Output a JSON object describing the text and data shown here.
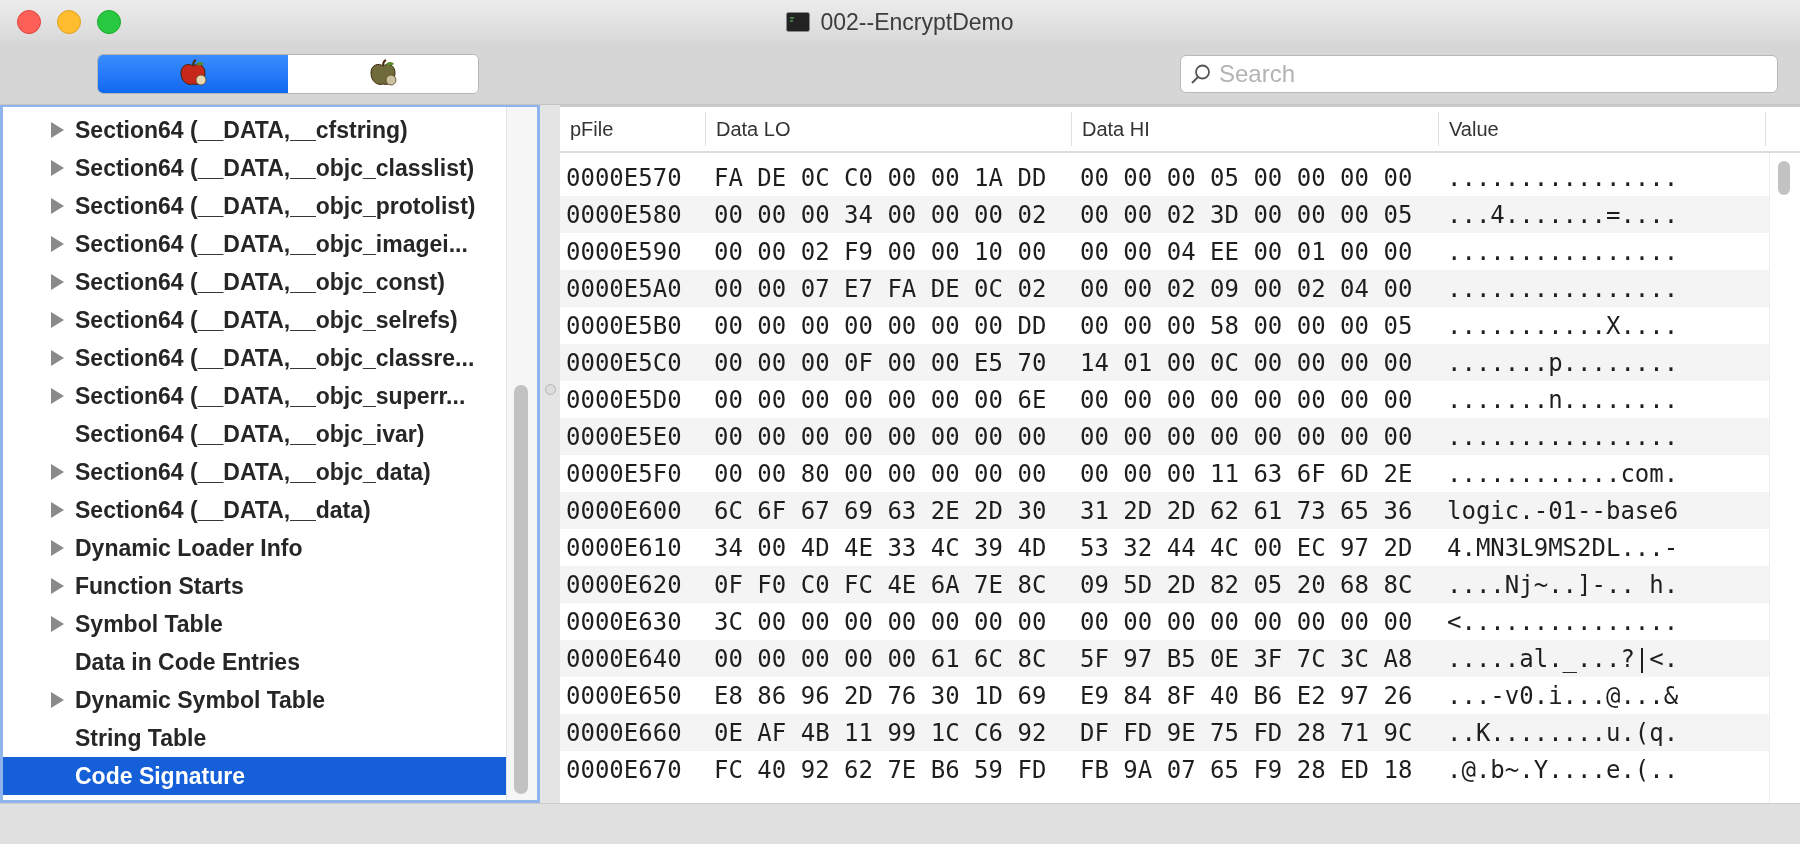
{
  "window": {
    "title": "002--EncryptDemo"
  },
  "segments": [
    {
      "selected": true
    },
    {
      "selected": false
    }
  ],
  "search": {
    "placeholder": "Search"
  },
  "tree": {
    "items": [
      {
        "label": "Section64 (__DATA,__cfstring)",
        "expandable": true,
        "selected": false
      },
      {
        "label": "Section64 (__DATA,__objc_classlist)",
        "expandable": true,
        "selected": false
      },
      {
        "label": "Section64 (__DATA,__objc_protolist)",
        "expandable": true,
        "selected": false
      },
      {
        "label": "Section64 (__DATA,__objc_imagei...",
        "expandable": true,
        "selected": false
      },
      {
        "label": "Section64 (__DATA,__objc_const)",
        "expandable": true,
        "selected": false
      },
      {
        "label": "Section64 (__DATA,__objc_selrefs)",
        "expandable": true,
        "selected": false
      },
      {
        "label": "Section64 (__DATA,__objc_classre...",
        "expandable": true,
        "selected": false
      },
      {
        "label": "Section64 (__DATA,__objc_superr...",
        "expandable": true,
        "selected": false
      },
      {
        "label": "Section64 (__DATA,__objc_ivar)",
        "expandable": false,
        "selected": false
      },
      {
        "label": "Section64 (__DATA,__objc_data)",
        "expandable": true,
        "selected": false
      },
      {
        "label": "Section64 (__DATA,__data)",
        "expandable": true,
        "selected": false
      },
      {
        "label": "Dynamic Loader Info",
        "expandable": true,
        "selected": false
      },
      {
        "label": "Function Starts",
        "expandable": true,
        "selected": false
      },
      {
        "label": "Symbol Table",
        "expandable": true,
        "selected": false
      },
      {
        "label": "Data in Code Entries",
        "expandable": false,
        "selected": false
      },
      {
        "label": "Dynamic Symbol Table",
        "expandable": true,
        "selected": false
      },
      {
        "label": "String Table",
        "expandable": false,
        "selected": false
      },
      {
        "label": "Code Signature",
        "expandable": false,
        "selected": true
      }
    ]
  },
  "table": {
    "columns": [
      "pFile",
      "Data LO",
      "Data HI",
      "Value"
    ],
    "rows": [
      [
        "0000E570",
        "FA DE 0C C0 00 00 1A DD",
        "00 00 00 05 00 00 00 00",
        "................"
      ],
      [
        "0000E580",
        "00 00 00 34 00 00 00 02",
        "00 00 02 3D 00 00 00 05",
        "...4.......=...."
      ],
      [
        "0000E590",
        "00 00 02 F9 00 00 10 00",
        "00 00 04 EE 00 01 00 00",
        "................"
      ],
      [
        "0000E5A0",
        "00 00 07 E7 FA DE 0C 02",
        "00 00 02 09 00 02 04 00",
        "................"
      ],
      [
        "0000E5B0",
        "00 00 00 00 00 00 00 DD",
        "00 00 00 58 00 00 00 05",
        "...........X...."
      ],
      [
        "0000E5C0",
        "00 00 00 0F 00 00 E5 70",
        "14 01 00 0C 00 00 00 00",
        ".......p........"
      ],
      [
        "0000E5D0",
        "00 00 00 00 00 00 00 6E",
        "00 00 00 00 00 00 00 00",
        ".......n........"
      ],
      [
        "0000E5E0",
        "00 00 00 00 00 00 00 00",
        "00 00 00 00 00 00 00 00",
        "................"
      ],
      [
        "0000E5F0",
        "00 00 80 00 00 00 00 00",
        "00 00 00 11 63 6F 6D 2E",
        "............com."
      ],
      [
        "0000E600",
        "6C 6F 67 69 63 2E 2D 30",
        "31 2D 2D 62 61 73 65 36",
        "logic.-01--base6"
      ],
      [
        "0000E610",
        "34 00 4D 4E 33 4C 39 4D",
        "53 32 44 4C 00 EC 97 2D",
        "4.MN3L9MS2DL...-"
      ],
      [
        "0000E620",
        "0F F0 C0 FC 4E 6A 7E 8C",
        "09 5D 2D 82 05 20 68 8C",
        "....Nj~..]-.. h."
      ],
      [
        "0000E630",
        "3C 00 00 00 00 00 00 00",
        "00 00 00 00 00 00 00 00",
        "<..............."
      ],
      [
        "0000E640",
        "00 00 00 00 00 61 6C 8C",
        "5F 97 B5 0E 3F 7C 3C A8",
        ".....al._...?|<."
      ],
      [
        "0000E650",
        "E8 86 96 2D 76 30 1D 69",
        "E9 84 8F 40 B6 E2 97 26",
        "...-v0.i...@...&"
      ],
      [
        "0000E660",
        "0E AF 4B 11 99 1C C6 92",
        "DF FD 9E 75 FD 28 71 9C",
        "..K........u.(q."
      ],
      [
        "0000E670",
        "FC 40 92 62 7E B6 59 FD",
        "FB 9A 07 65 F9 28 ED 18",
        ".@.b~.Y....e.(.."
      ]
    ]
  }
}
